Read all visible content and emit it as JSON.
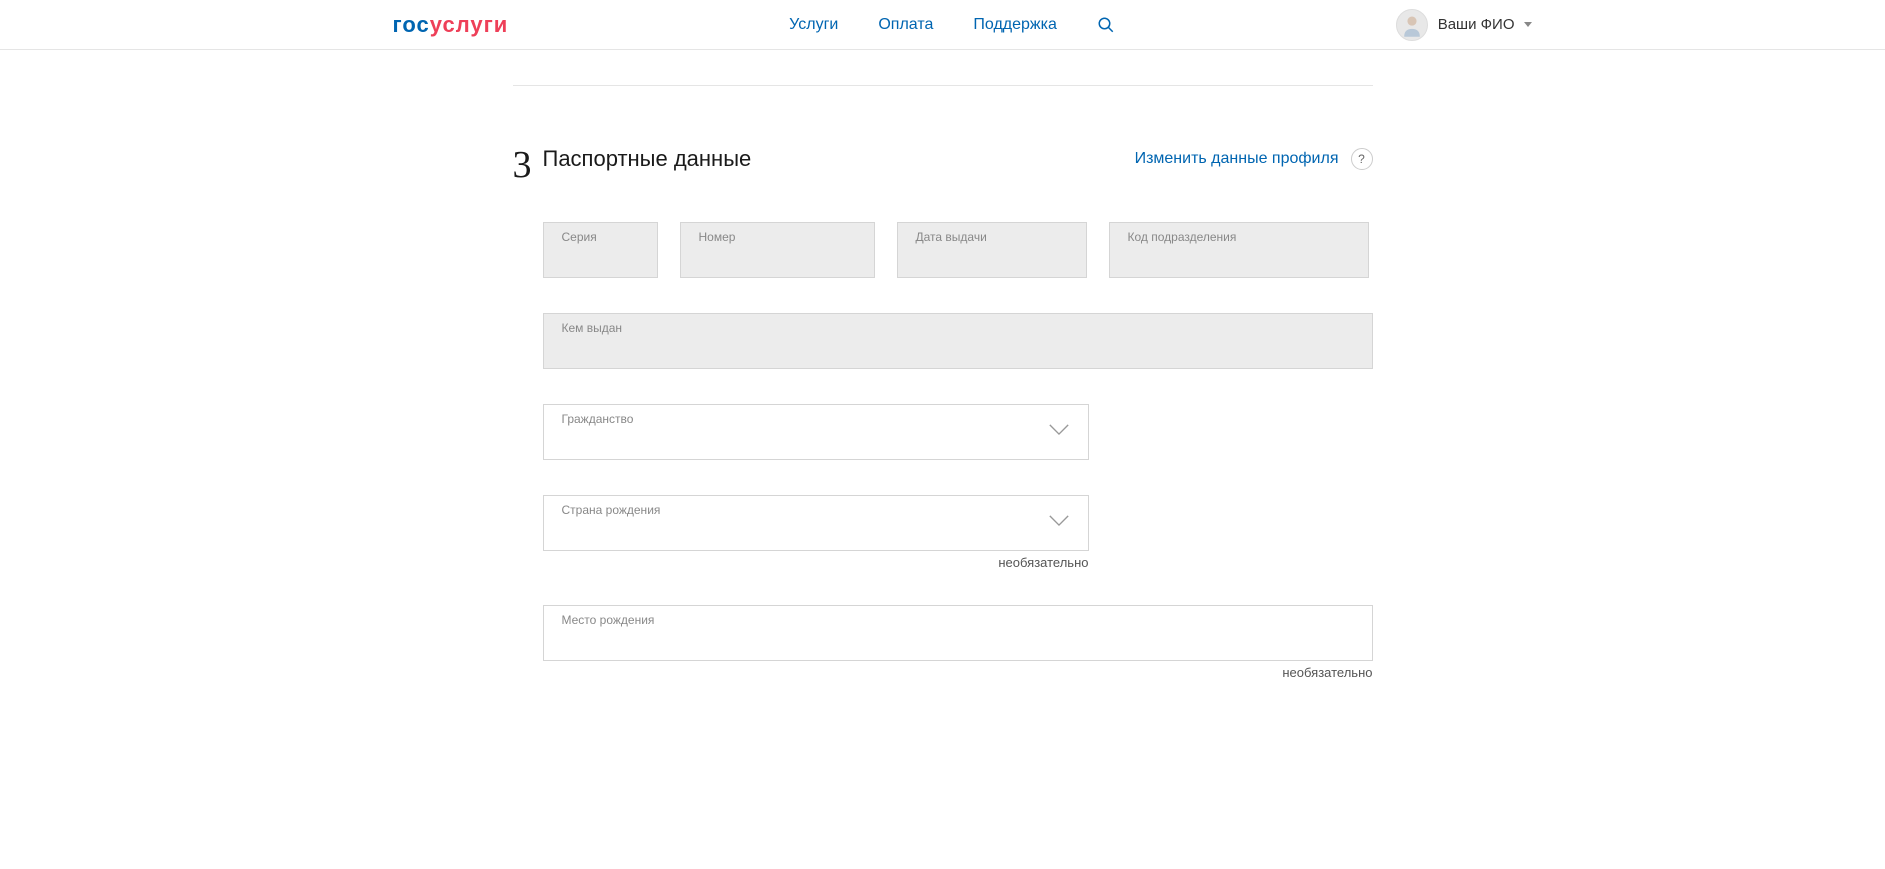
{
  "header": {
    "logo": {
      "part1": "гос",
      "part2": "услуги"
    },
    "nav": {
      "services": "Услуги",
      "payment": "Оплата",
      "support": "Поддержка"
    },
    "user": {
      "name": "Ваши ФИО"
    }
  },
  "section": {
    "number": "3",
    "title": "Паспортные данные",
    "changeLink": "Изменить данные профиля",
    "helpSymbol": "?"
  },
  "fields": {
    "series": {
      "label": "Серия",
      "value": ""
    },
    "number": {
      "label": "Номер",
      "value": ""
    },
    "issueDate": {
      "label": "Дата выдачи",
      "value": ""
    },
    "departmentCode": {
      "label": "Код подразделения",
      "value": ""
    },
    "issuedBy": {
      "label": "Кем выдан",
      "value": ""
    },
    "citizenship": {
      "label": "Гражданство",
      "value": ""
    },
    "birthCountry": {
      "label": "Страна рождения",
      "value": "",
      "hint": "необязательно"
    },
    "birthPlace": {
      "label": "Место рождения",
      "value": "",
      "hint": "необязательно"
    }
  }
}
